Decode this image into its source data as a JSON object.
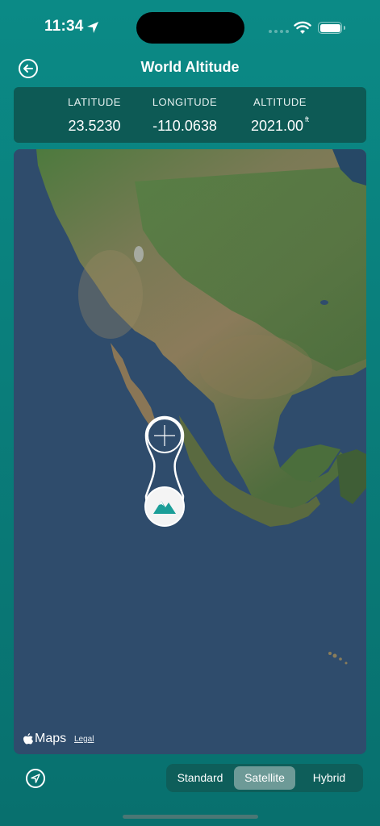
{
  "status_bar": {
    "time": "11:34"
  },
  "header": {
    "title": "World Altitude",
    "back_icon": "arrow-left-circle-icon"
  },
  "readout": {
    "latitude_label": "LATITUDE",
    "latitude_value": "23.5230",
    "longitude_label": "LONGITUDE",
    "longitude_value": "-110.0638",
    "altitude_label": "ALTITUDE",
    "altitude_value": "2021.00",
    "altitude_unit": "ft"
  },
  "map": {
    "attribution": "Maps",
    "legal": "Legal",
    "pin_icon": "mountain-icon"
  },
  "bottom_bar": {
    "locate_icon": "location-arrow-icon",
    "map_types": [
      "Standard",
      "Satellite",
      "Hybrid"
    ],
    "selected": "Satellite"
  },
  "colors": {
    "background": "#0a7f7c",
    "card": "#0d5a55",
    "accent": "#1b9e98",
    "ocean": "#2f4c6c"
  }
}
